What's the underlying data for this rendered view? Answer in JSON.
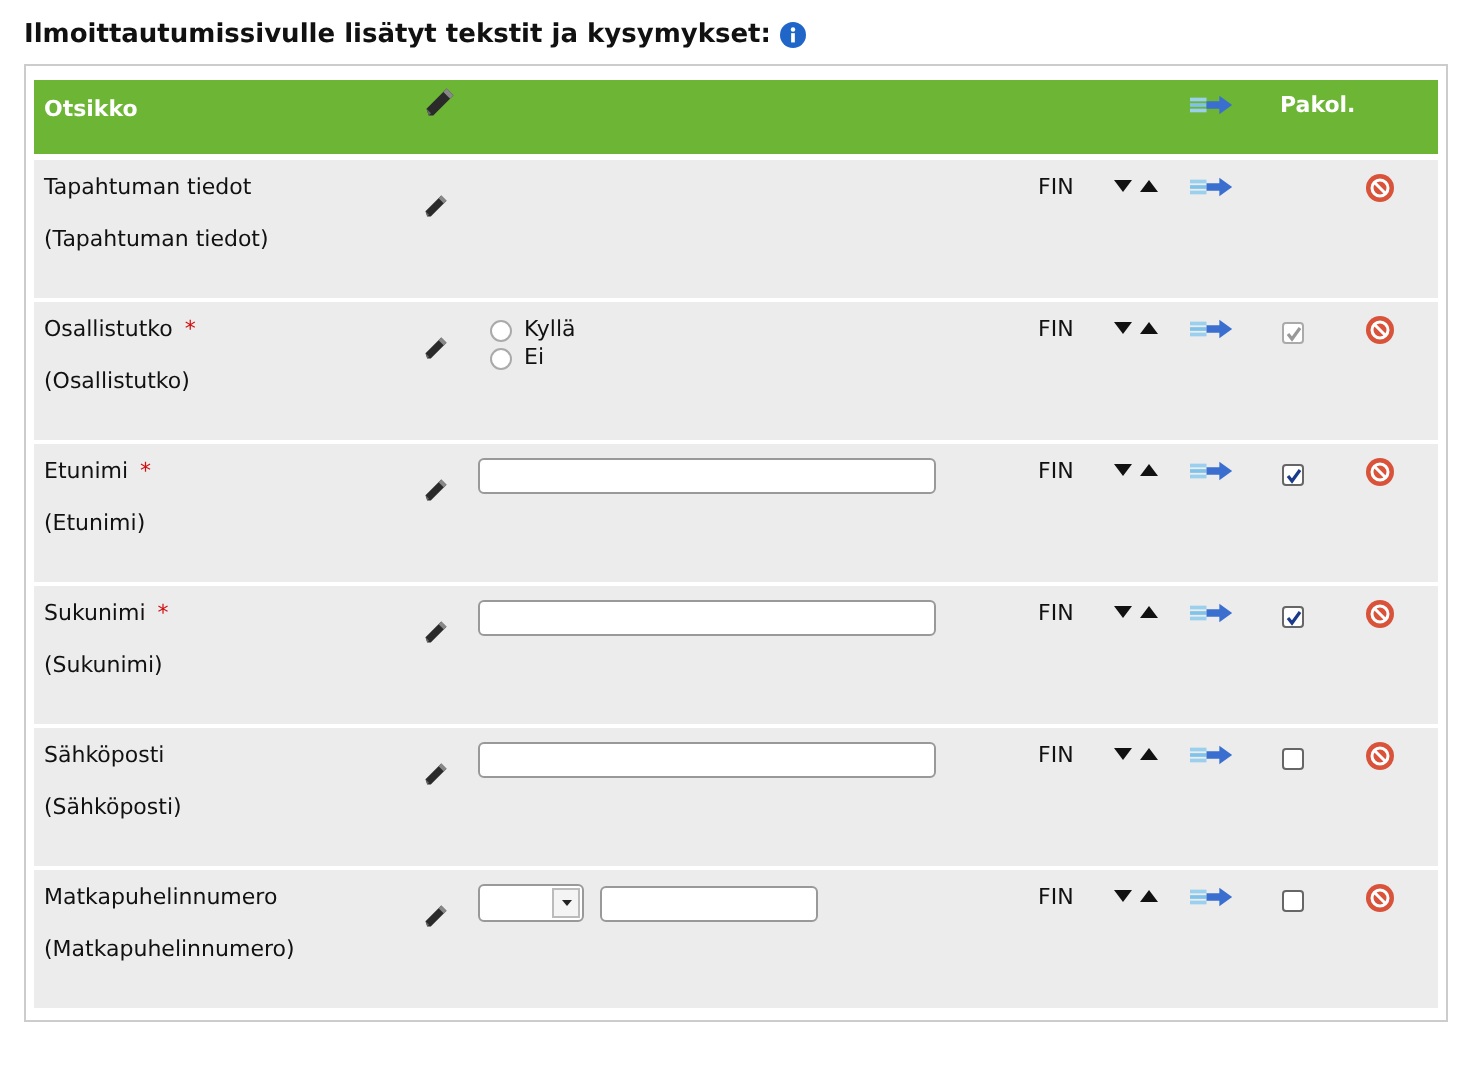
{
  "heading": "Ilmoittautumissivulle lisätyt tekstit ja kysymykset:",
  "table": {
    "columns": {
      "title": "Otsikko",
      "mandatory": "Pakol."
    },
    "rows": [
      {
        "title": "Tapahtuman tiedot",
        "subtitle": "(Tapahtuman tiedot)",
        "kind": "none",
        "language": "FIN"
      },
      {
        "title": "Osallistutko",
        "subtitle": "(Osallistutko)",
        "required_mark": "*",
        "kind": "radio",
        "options": [
          {
            "label": "Kyllä",
            "selected": false
          },
          {
            "label": "Ei",
            "selected": false
          }
        ],
        "language": "FIN",
        "mandatory": {
          "checked": true,
          "disabled": true
        }
      },
      {
        "title": "Etunimi",
        "subtitle": "(Etunimi)",
        "required_mark": "*",
        "kind": "text",
        "language": "FIN",
        "mandatory": {
          "checked": true,
          "disabled": false
        }
      },
      {
        "title": "Sukunimi",
        "subtitle": "(Sukunimi)",
        "required_mark": "*",
        "kind": "text",
        "language": "FIN",
        "mandatory": {
          "checked": true,
          "disabled": false
        }
      },
      {
        "title": "Sähköposti",
        "subtitle": "(Sähköposti)",
        "kind": "text",
        "language": "FIN",
        "mandatory": {
          "checked": false,
          "disabled": false
        }
      },
      {
        "title": "Matkapuhelinnumero",
        "subtitle": "(Matkapuhelinnumero)",
        "kind": "phone",
        "language": "FIN",
        "mandatory": {
          "checked": false,
          "disabled": false
        }
      }
    ]
  }
}
